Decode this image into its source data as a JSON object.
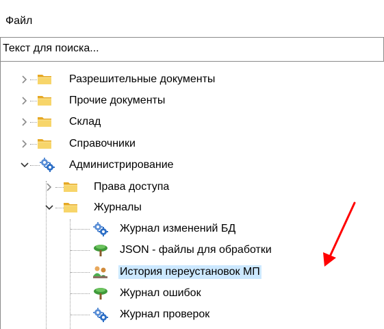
{
  "menu": {
    "file_label": "Файл"
  },
  "search": {
    "placeholder": "Текст для поиска..."
  },
  "tree": {
    "permits": "Разрешительные документы",
    "other_docs": "Прочие документы",
    "warehouse": "Склад",
    "references": "Справочники",
    "administration": "Администрирование",
    "access_rights": "Права доступа",
    "journals": "Журналы",
    "db_changes": "Журнал изменений БД",
    "json_files": "JSON - файлы для обработки",
    "mp_reinstall": "История переустановок МП",
    "errors_log": "Журнал ошибок",
    "checks_log": "Журнал проверок"
  },
  "colors": {
    "selection": "#cce8ff",
    "annotation_arrow": "#ff0000",
    "folder": "#f5c64a"
  },
  "icons": {
    "collapsed": "chevron-right-icon",
    "expanded": "chevron-down-icon",
    "folder": "folder-icon",
    "gears": "gears-icon",
    "tree": "tree-icon",
    "people": "people-icon"
  }
}
